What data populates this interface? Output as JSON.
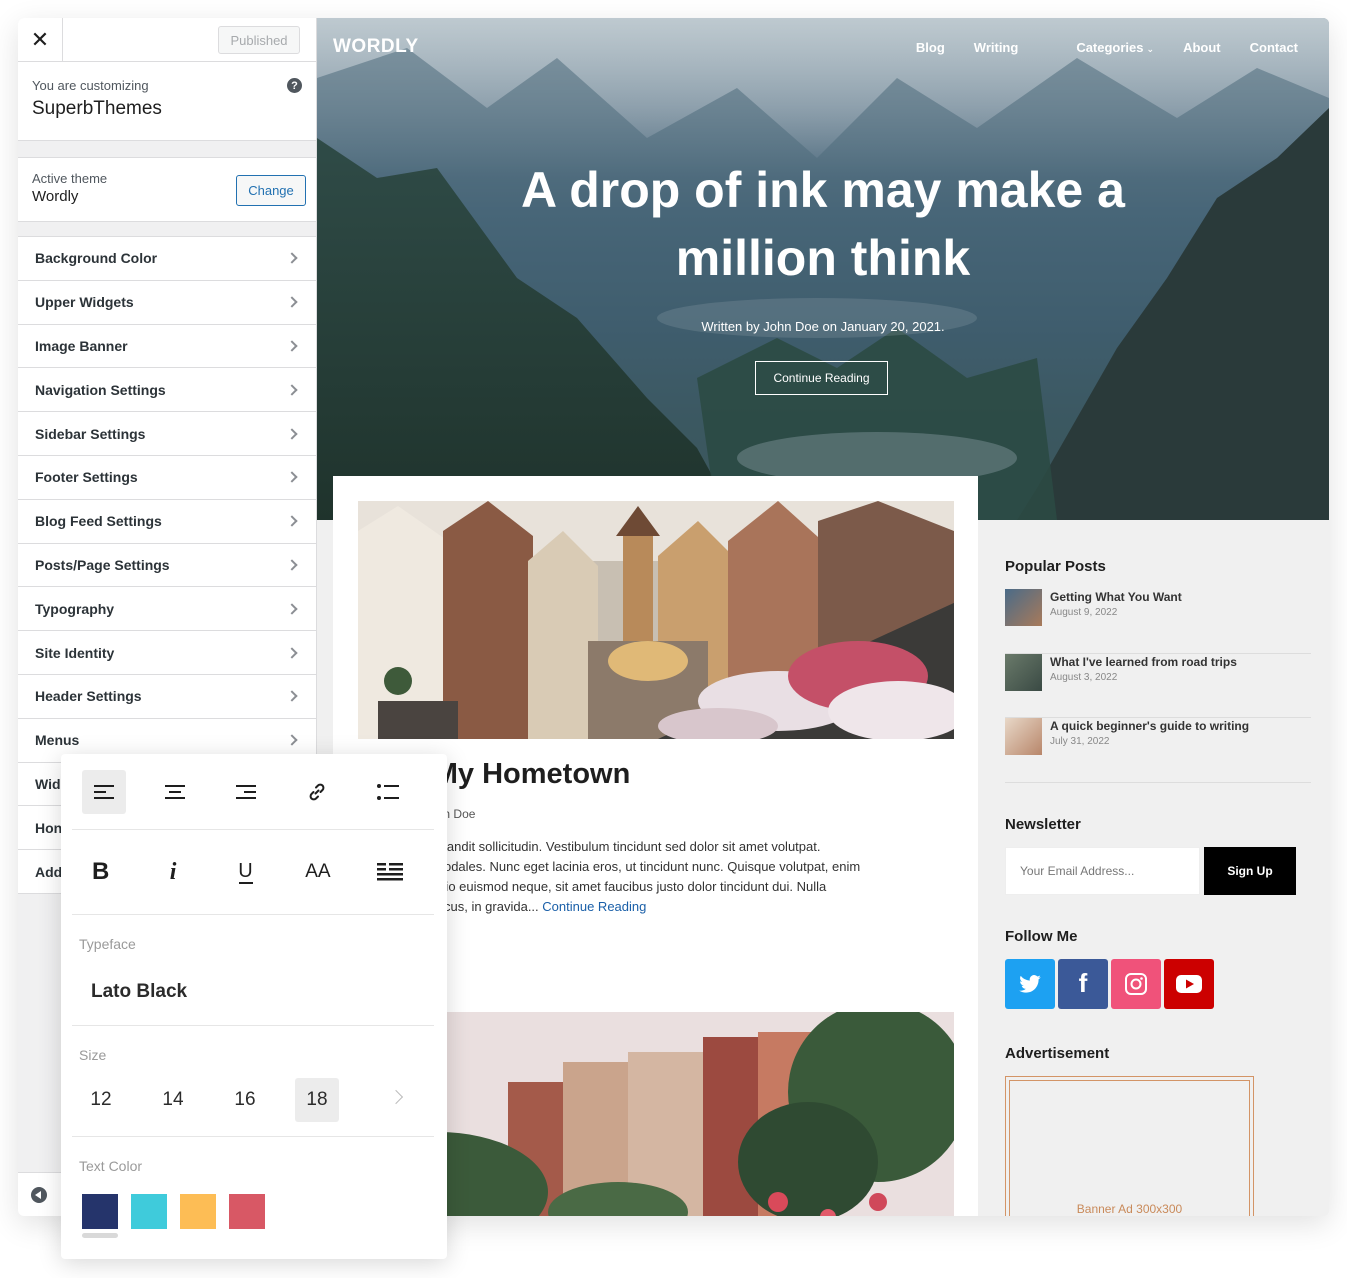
{
  "customizer": {
    "published_label": "Published",
    "customizing_label": "You are customizing",
    "site_name": "SuperbThemes",
    "active_theme_label": "Active theme",
    "active_theme_name": "Wordly",
    "change_label": "Change",
    "menu": [
      "Background Color",
      "Upper Widgets",
      "Image Banner",
      "Navigation Settings",
      "Sidebar Settings",
      "Footer Settings",
      "Blog Feed Settings",
      "Posts/Page Settings",
      "Typography",
      "Site Identity",
      "Header Settings",
      "Menus",
      "Wid",
      "Hon",
      "Add"
    ]
  },
  "site": {
    "logo": "WORDLY",
    "nav": [
      "Blog",
      "Writing",
      "Categories",
      "About",
      "Contact"
    ],
    "hero": {
      "title_line1": "A drop of ink may make a",
      "title_line2": "million think",
      "meta": "Written by John Doe on January 20, 2021.",
      "button": "Continue Reading"
    },
    "post": {
      "title": "Love My Hometown",
      "meta": "24, 2022 by John Doe",
      "excerpt_lines": [
        "velit vitae dui blandit sollicitudin. Vestibulum tincidunt sed dolor sit amet volutpat.",
        "sem at mollis sodales. Nunc eget lacinia eros, ut tincidunt nunc. Quisque volutpat, enim",
        "rdum, purus odio euismod neque, sit amet faucibus justo dolor tincidunt dui. Nulla",
        "s in tincidunt lacus, in gravida..."
      ],
      "more": "Continue Reading"
    },
    "sidebar": {
      "popular_title": "Popular Posts",
      "popular": [
        {
          "title": "Getting What You Want",
          "date": "August 9, 2022"
        },
        {
          "title": "What I've learned from road trips",
          "date": "August 3, 2022"
        },
        {
          "title": "A quick beginner's guide to writing",
          "date": "July 31, 2022"
        }
      ],
      "newsletter_title": "Newsletter",
      "newsletter_placeholder": "Your Email Address...",
      "newsletter_button": "Sign Up",
      "follow_title": "Follow Me",
      "social": [
        {
          "name": "twitter-icon",
          "color": "#1da1f2"
        },
        {
          "name": "facebook-icon",
          "color": "#3b5998"
        },
        {
          "name": "instagram-icon",
          "color": "#f0527a"
        },
        {
          "name": "youtube-icon",
          "color": "#cc0000"
        }
      ],
      "ad_title": "Advertisement",
      "ad_label": "Banner Ad 300x300"
    }
  },
  "panel": {
    "tools": [
      "align-left-icon",
      "align-center-icon",
      "align-right-icon",
      "link-icon",
      "list-icon"
    ],
    "format": {
      "bold": "B",
      "italic": "i",
      "underline": "U",
      "case": "AA"
    },
    "typeface_label": "Typeface",
    "typeface_value": "Lato Black",
    "size_label": "Size",
    "sizes": [
      "12",
      "14",
      "16",
      "18"
    ],
    "active_size": "18",
    "text_color_label": "Text Color",
    "colors": [
      "#25346b",
      "#3fcbdb",
      "#fdbd55",
      "#d85865"
    ]
  }
}
